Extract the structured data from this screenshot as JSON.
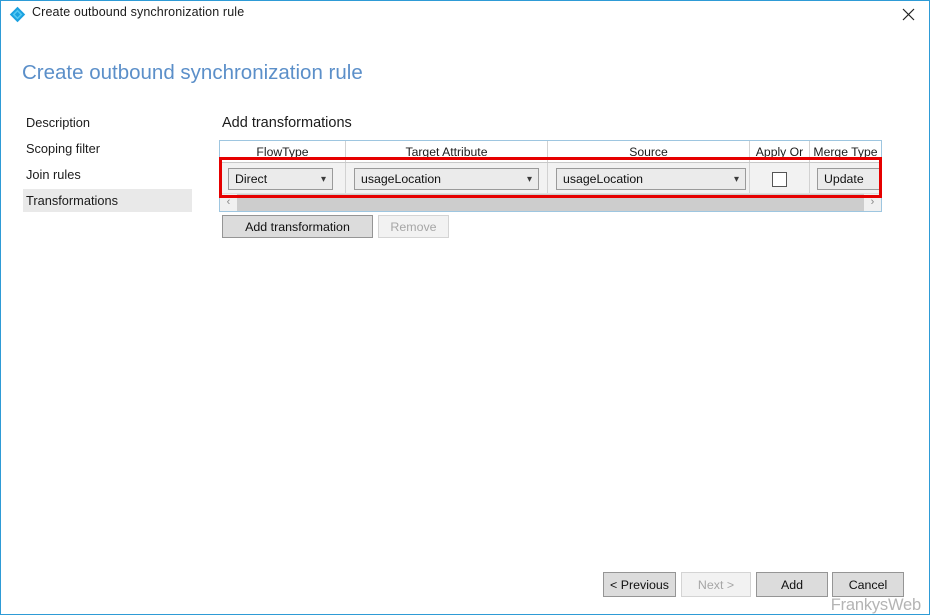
{
  "window": {
    "titlebar_title": "Create outbound synchronization rule",
    "title_icon": "azure-diamond-icon",
    "close_icon": "close-icon",
    "accent_border_color": "#2e9bd6"
  },
  "page": {
    "heading": "Create outbound synchronization rule",
    "heading_color": "#5b8fc9"
  },
  "sidebar": {
    "items": [
      {
        "label": "Description",
        "selected": false
      },
      {
        "label": "Scoping filter",
        "selected": false
      },
      {
        "label": "Join rules",
        "selected": false
      },
      {
        "label": "Transformations",
        "selected": true
      }
    ]
  },
  "main": {
    "section_title": "Add transformations",
    "grid": {
      "columns": [
        {
          "label": "FlowType"
        },
        {
          "label": "Target Attribute"
        },
        {
          "label": "Source"
        },
        {
          "label": "Apply Or"
        },
        {
          "label": "Merge Type"
        }
      ],
      "rows": [
        {
          "flow_type": "Direct",
          "target_attribute": "usageLocation",
          "source": "usageLocation",
          "apply_once": false,
          "merge_type": "Update"
        }
      ],
      "scrollbar": {
        "left_arrow": "‹",
        "right_arrow": "›"
      }
    },
    "buttons": {
      "add_transformation": "Add transformation",
      "remove": "Remove",
      "remove_disabled": true
    },
    "annotation": {
      "highlight_color": "#e60000"
    }
  },
  "footer": {
    "previous": "< Previous",
    "next": "Next >",
    "next_disabled": true,
    "add": "Add",
    "cancel": "Cancel"
  },
  "watermark": {
    "text": "FrankysWeb"
  }
}
